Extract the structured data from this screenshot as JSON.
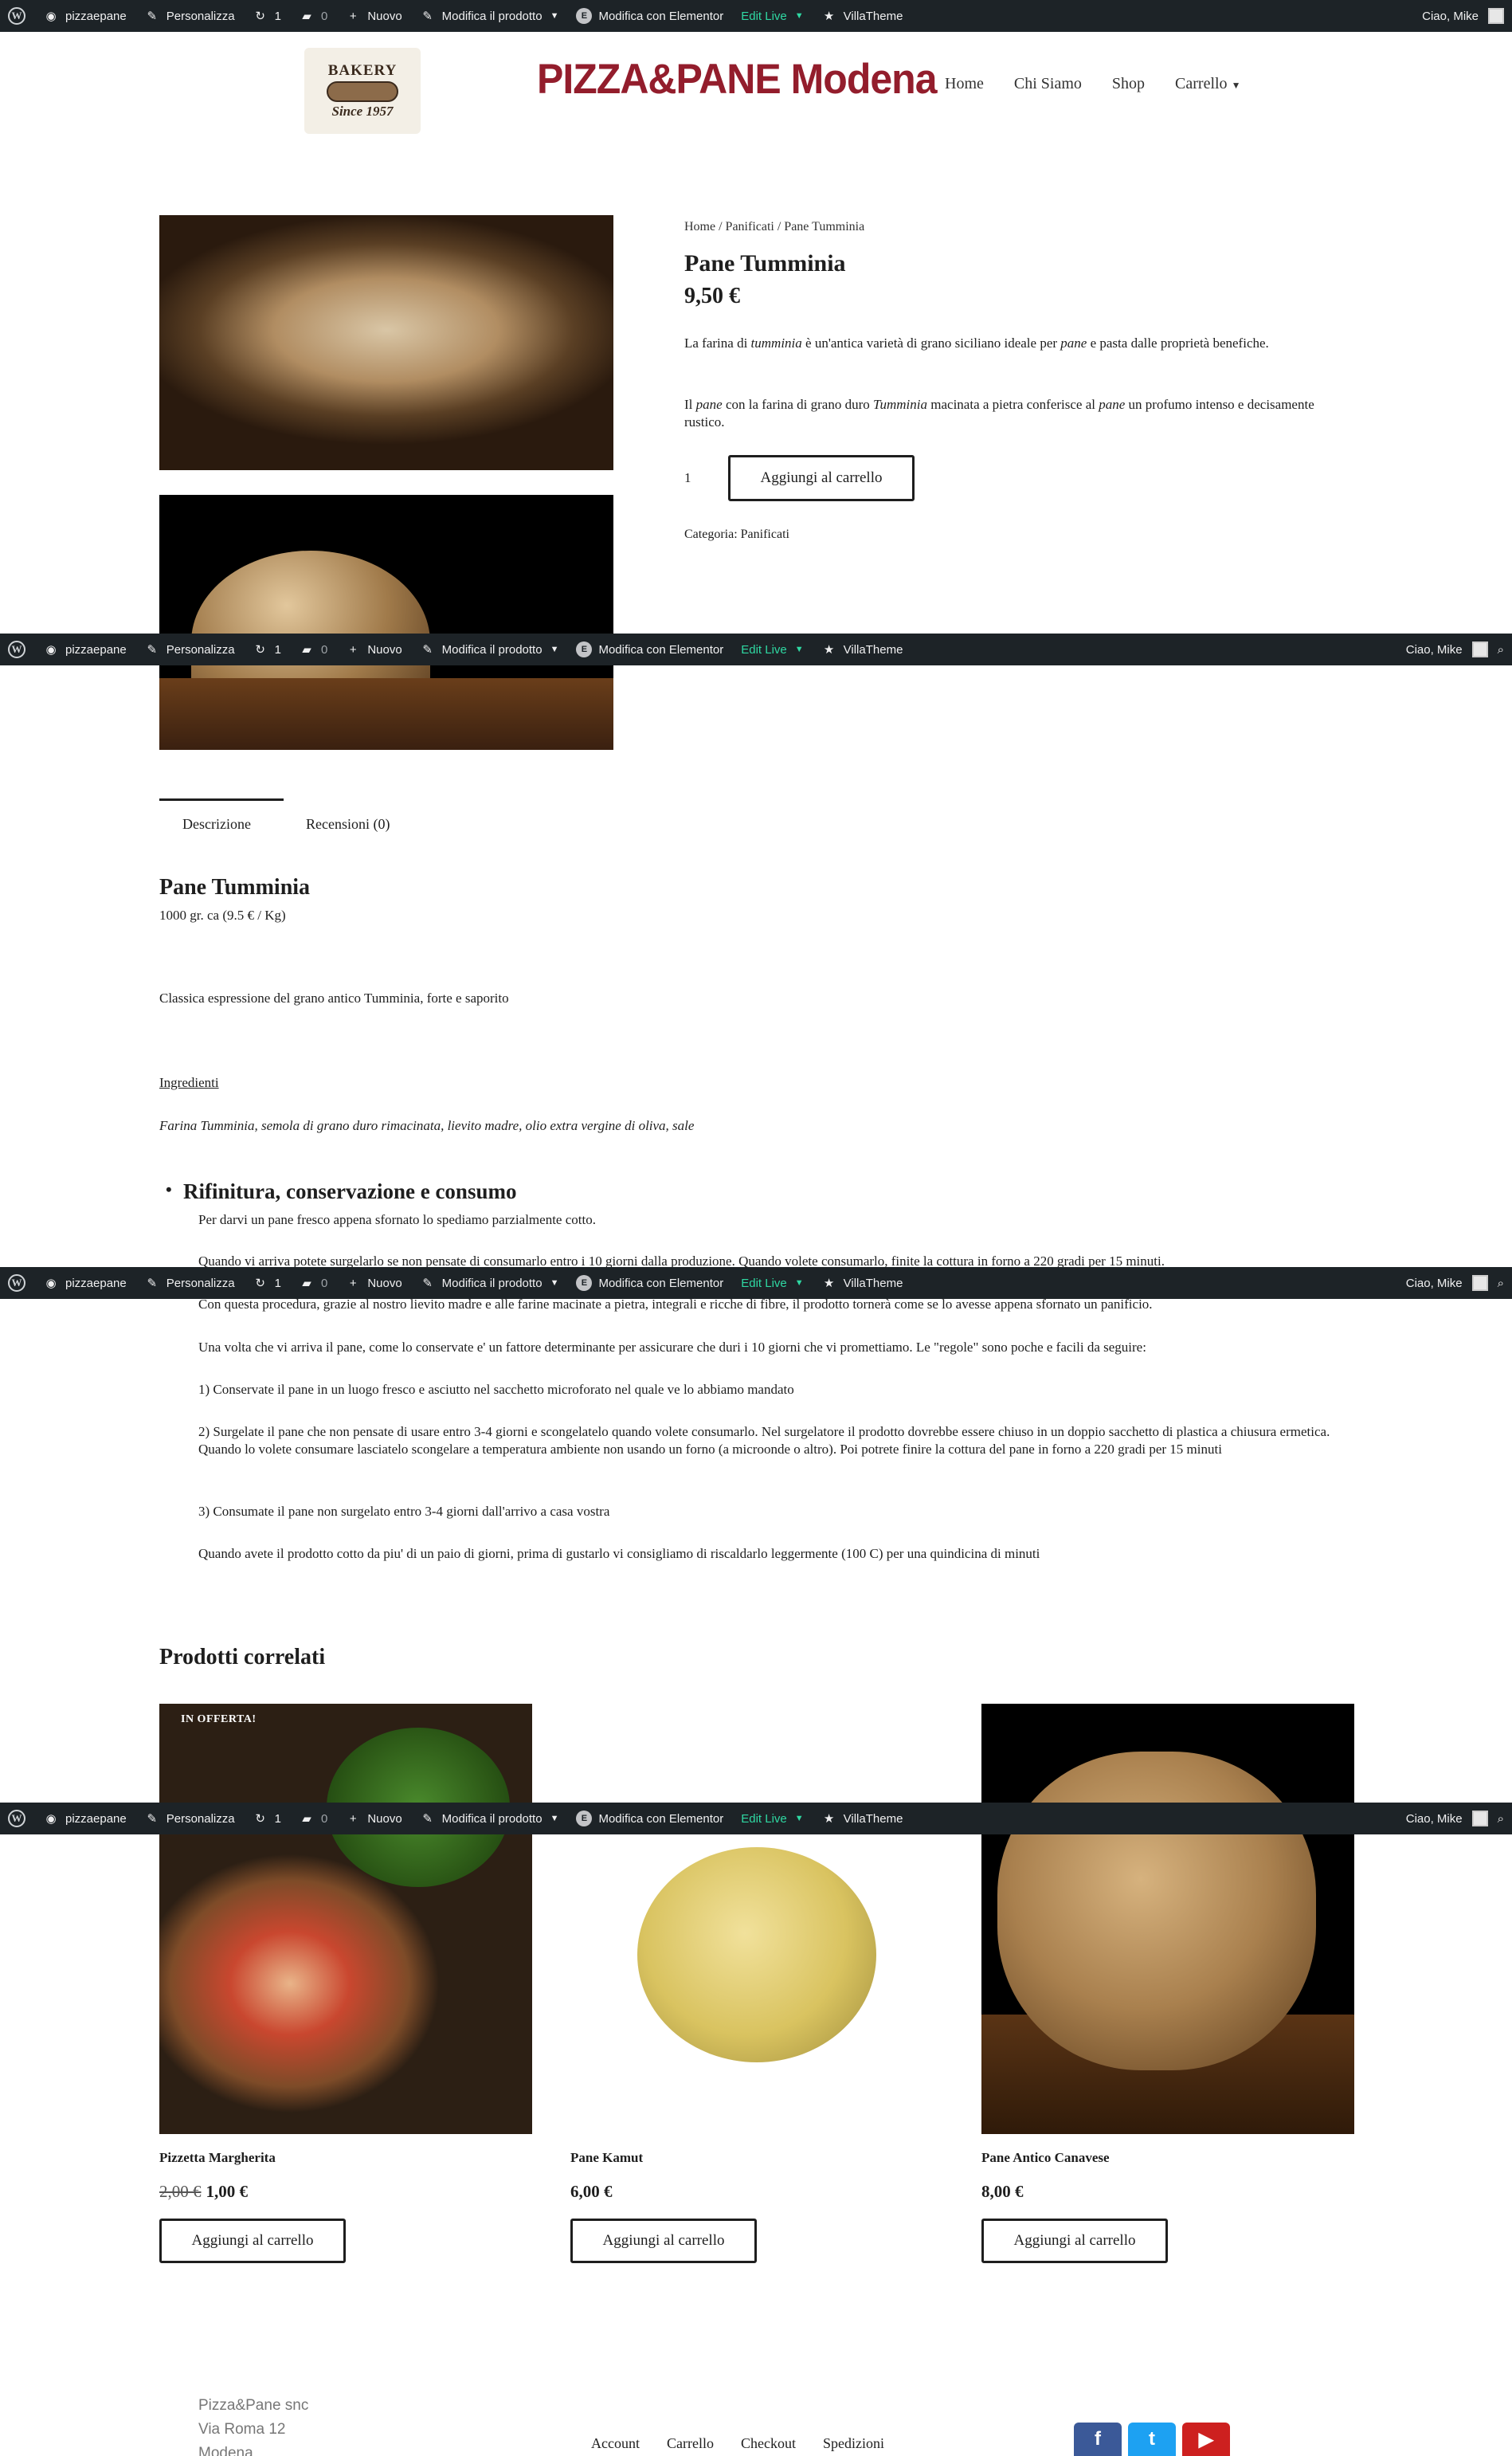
{
  "adminbar": {
    "site": "pizzaepane",
    "customize": "Personalizza",
    "updates": "1",
    "comments": "0",
    "new": "Nuovo",
    "edit_product": "Modifica il prodotto",
    "elementor": "Modifica con Elementor",
    "edit_live": "Edit Live",
    "villatheme": "VillaTheme",
    "greeting": "Ciao, Mike"
  },
  "header": {
    "logo_top": "BAKERY",
    "logo_bottom": "Since 1957",
    "brand": "PIZZA&PANE Modena",
    "nav": [
      "Home",
      "Chi Siamo",
      "Shop",
      "Carrello"
    ]
  },
  "product": {
    "breadcrumb": "Home / Panificati / Pane Tumminia",
    "title": "Pane Tumminia",
    "price": "9,50 €",
    "desc1_a": "La farina di ",
    "desc1_b": "tumminia",
    "desc1_c": " è un'antica varietà di grano siciliano ideale per ",
    "desc1_d": "pane",
    "desc1_e": " e pasta dalle proprietà benefiche.",
    "desc2_a": "Il ",
    "desc2_b": "pane",
    "desc2_c": " con la farina di grano duro ",
    "desc2_d": "Tumminia",
    "desc2_e": " macinata a pietra conferisce al ",
    "desc2_f": "pane",
    "desc2_g": " un profumo intenso e decisamente rustico.",
    "quantity": "1",
    "add_to_cart": "Aggiungi al carrello",
    "category": "Categoria: Panificati"
  },
  "tabs": [
    "Descrizione",
    "Recensioni (0)"
  ],
  "description": {
    "title": "Pane Tumminia",
    "weight": "1000 gr. ca (9.5 € / Kg)",
    "intro": "Classica espressione del grano antico Tumminia, forte e saporito",
    "ingredients_label": "Ingredienti",
    "ingredients": "Farina Tumminia, semola di grano duro rimacinata, lievito madre, olio extra vergine di oliva, sale",
    "bullet_title": "Rifinitura, conservazione e consumo",
    "p1": "Per darvi un pane fresco appena sfornato lo spediamo parzialmente cotto.",
    "p2": "Quando vi arriva potete surgelarlo se non pensate di consumarlo entro i 10 giorni dalla produzione. Quando volete consumarlo, finite la cottura in forno a 220 gradi per 15 minuti.",
    "p3": "Con questa procedura, grazie al nostro lievito madre e alle farine macinate a pietra, integrali e ricche di fibre, il prodotto tornerà  come se lo avesse appena sfornato un panificio.",
    "p4": "Una volta che vi arriva il pane, come lo conservate e' un fattore determinante per assicurare che duri i 10 giorni che vi promettiamo. Le \"regole\" sono poche e facili da seguire:",
    "p5": "1) Conservate il pane in un luogo fresco e asciutto nel sacchetto microforato nel quale ve lo abbiamo mandato",
    "p6": "2) Surgelate il pane che non pensate di usare entro 3-4 giorni e scongelatelo quando volete consumarlo. Nel surgelatore il prodotto dovrebbe essere chiuso in un doppio sacchetto di plastica a chiusura ermetica. Quando lo volete consumare lasciatelo scongelare a temperatura ambiente non usando un forno (a microonde o altro). Poi potrete finire la cottura del pane in forno a 220 gradi per 15 minuti",
    "p7": "3) Consumate il pane non surgelato entro 3-4 giorni dall'arrivo a casa vostra",
    "p8": "Quando avete il prodotto cotto da piu' di un paio di giorni, prima di gustarlo vi consigliamo di riscaldarlo leggermente (100 C) per una quindicina di minuti"
  },
  "related": {
    "title": "Prodotti correlati",
    "badge": "IN OFFERTA!",
    "items": [
      {
        "name": "Pizzetta Margherita",
        "old_price": "2,00 €",
        "price": "1,00 €",
        "button": "Aggiungi al carrello"
      },
      {
        "name": "Pane Kamut",
        "price": "6,00 €",
        "button": "Aggiungi al carrello"
      },
      {
        "name": "Pane Antico Canavese",
        "price": "8,00 €",
        "button": "Aggiungi al carrello"
      }
    ]
  },
  "footer": {
    "company": "Pizza&Pane snc",
    "address": "Via Roma 12",
    "city": "Modena",
    "nav": [
      "Account",
      "Carrello",
      "Checkout",
      "Spedizioni"
    ]
  },
  "colors": {
    "brand": "#931d2c",
    "adminbar": "#1d2327",
    "edit_live": "#2fd9a3",
    "facebook": "#3b5998",
    "twitter": "#1da1f2",
    "youtube": "#cd201f"
  }
}
